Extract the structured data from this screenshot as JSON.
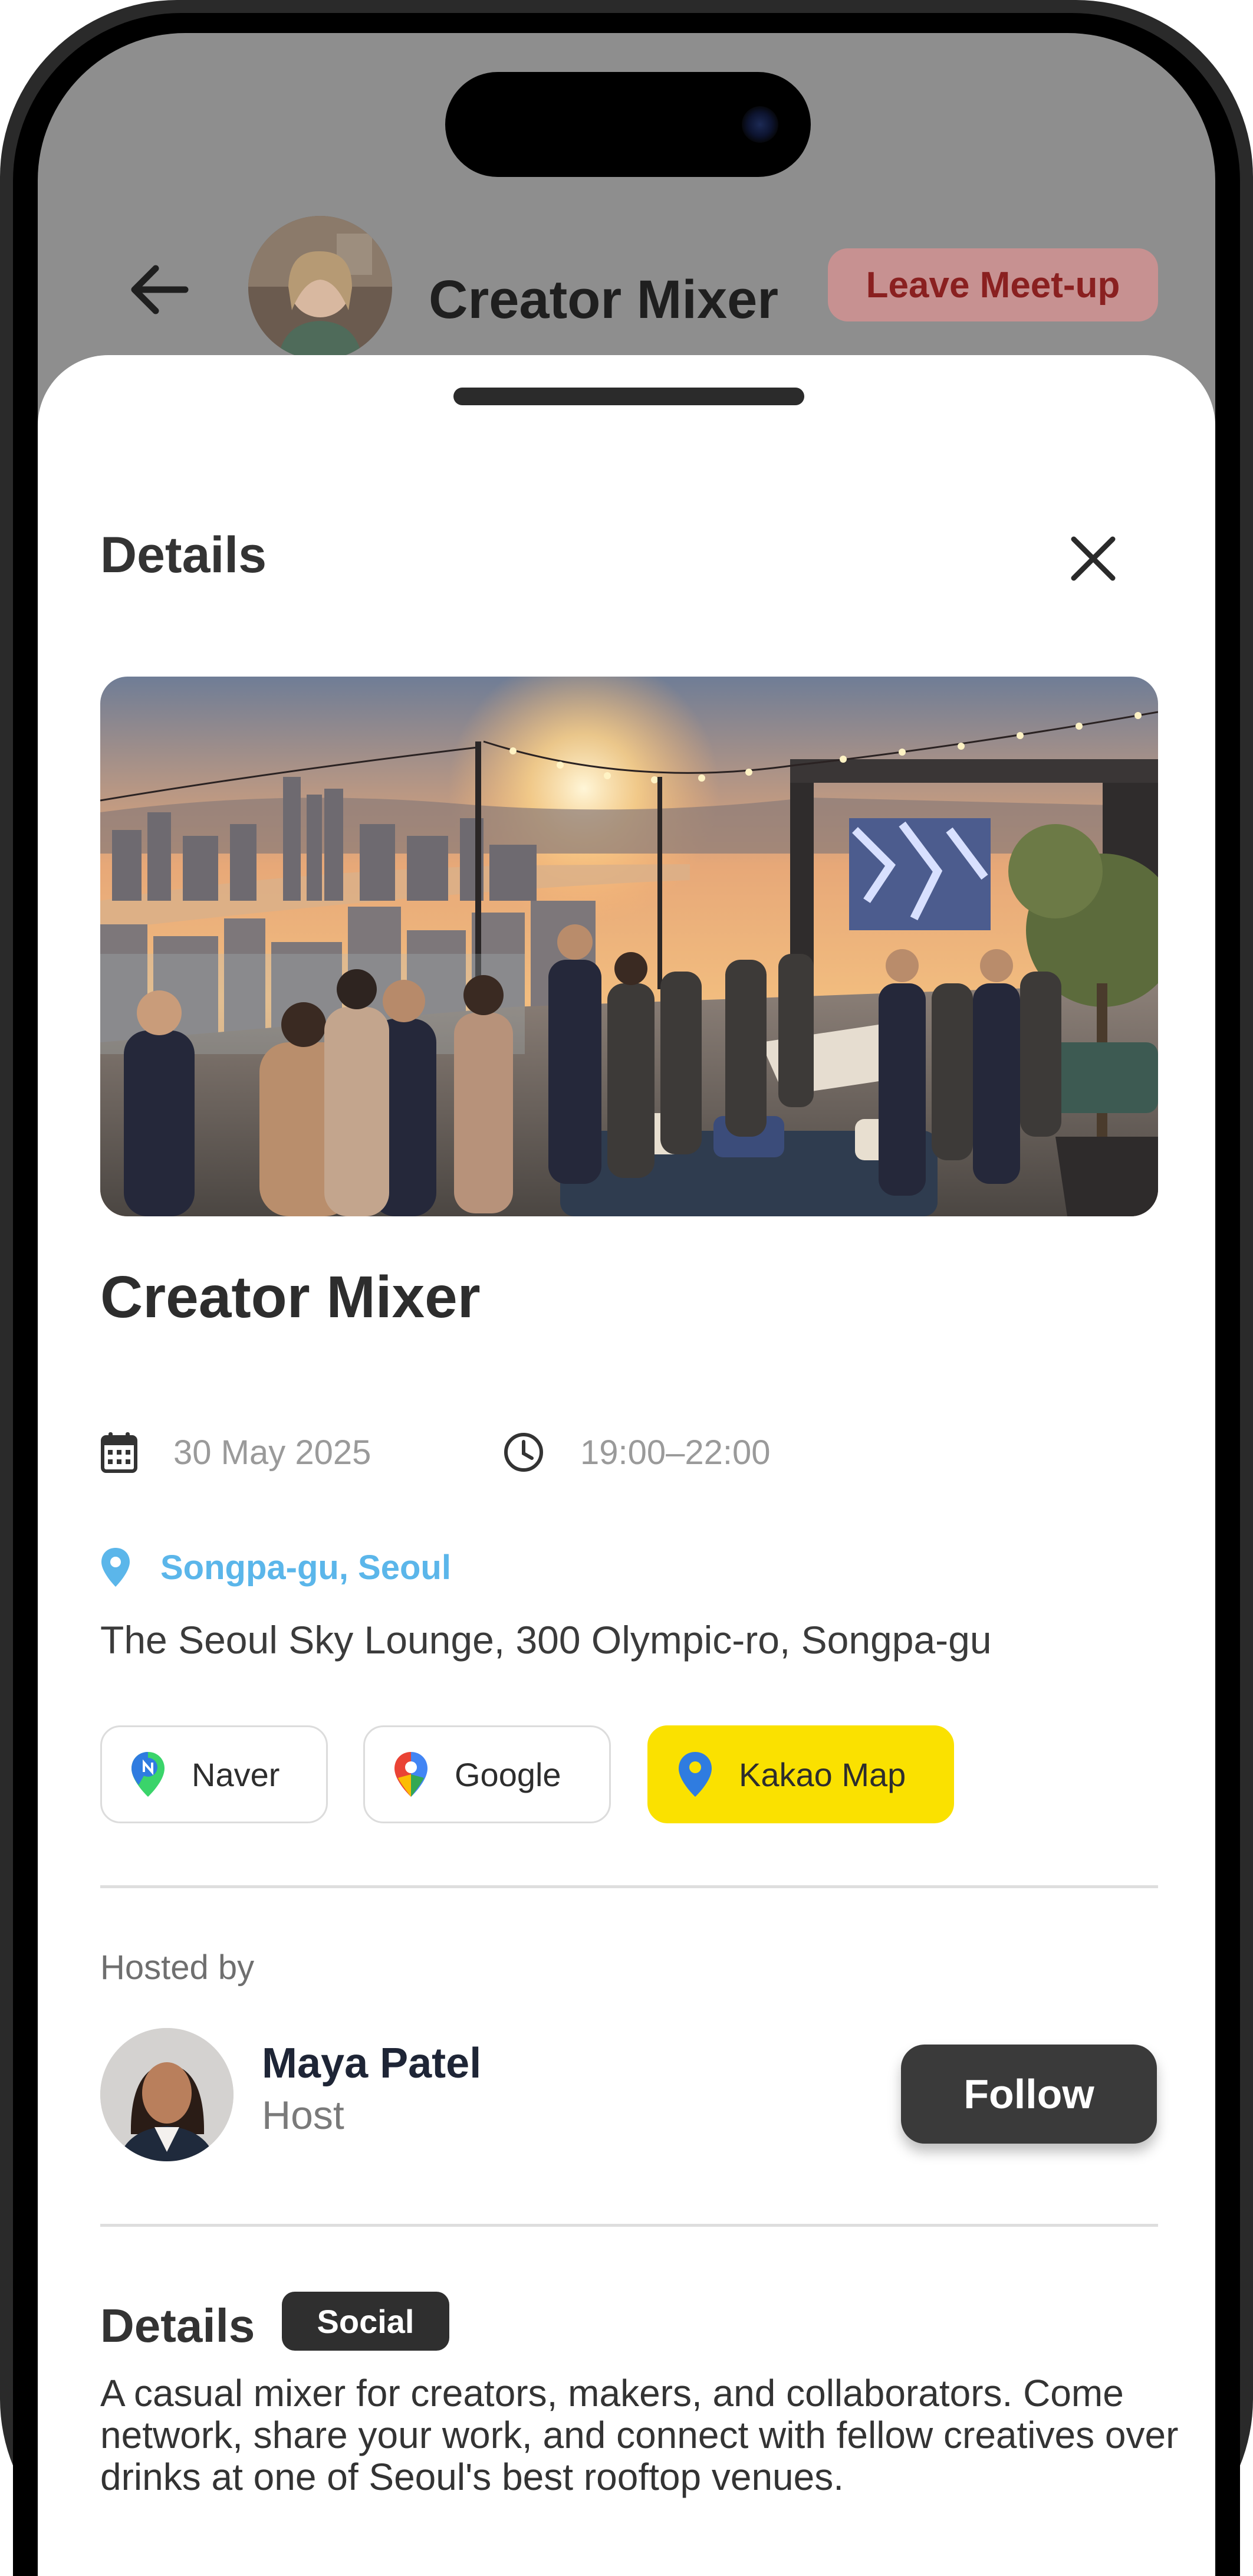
{
  "header": {
    "title": "Creator Mixer",
    "leave_label": "Leave Meet-up"
  },
  "sheet": {
    "title": "Details"
  },
  "event": {
    "title": "Creator Mixer",
    "date": "30 May 2025",
    "time": "19:00–22:00",
    "area": "Songpa-gu, Seoul",
    "address": "The Seoul Sky Lounge, 300 Olympic-ro, Songpa-gu"
  },
  "maps": [
    {
      "label": "Naver",
      "icon": "naver-pin-icon"
    },
    {
      "label": "Google",
      "icon": "google-maps-icon"
    },
    {
      "label": "Kakao Map",
      "icon": "kakao-pin-icon"
    }
  ],
  "host": {
    "section_label": "Hosted by",
    "name": "Maya Patel",
    "role": "Host",
    "follow_label": "Follow"
  },
  "details": {
    "heading": "Details",
    "tag": "Social",
    "description": "A casual mixer for creators, makers, and collaborators. Come network, share your work, and connect with fellow creatives over drinks at one of Seoul's best rooftop venues."
  },
  "colors": {
    "accent_location": "#5bb6ea",
    "kakao_yellow": "#fae100",
    "leave_bg": "#c79191",
    "follow_bg": "#3a3a3a"
  }
}
